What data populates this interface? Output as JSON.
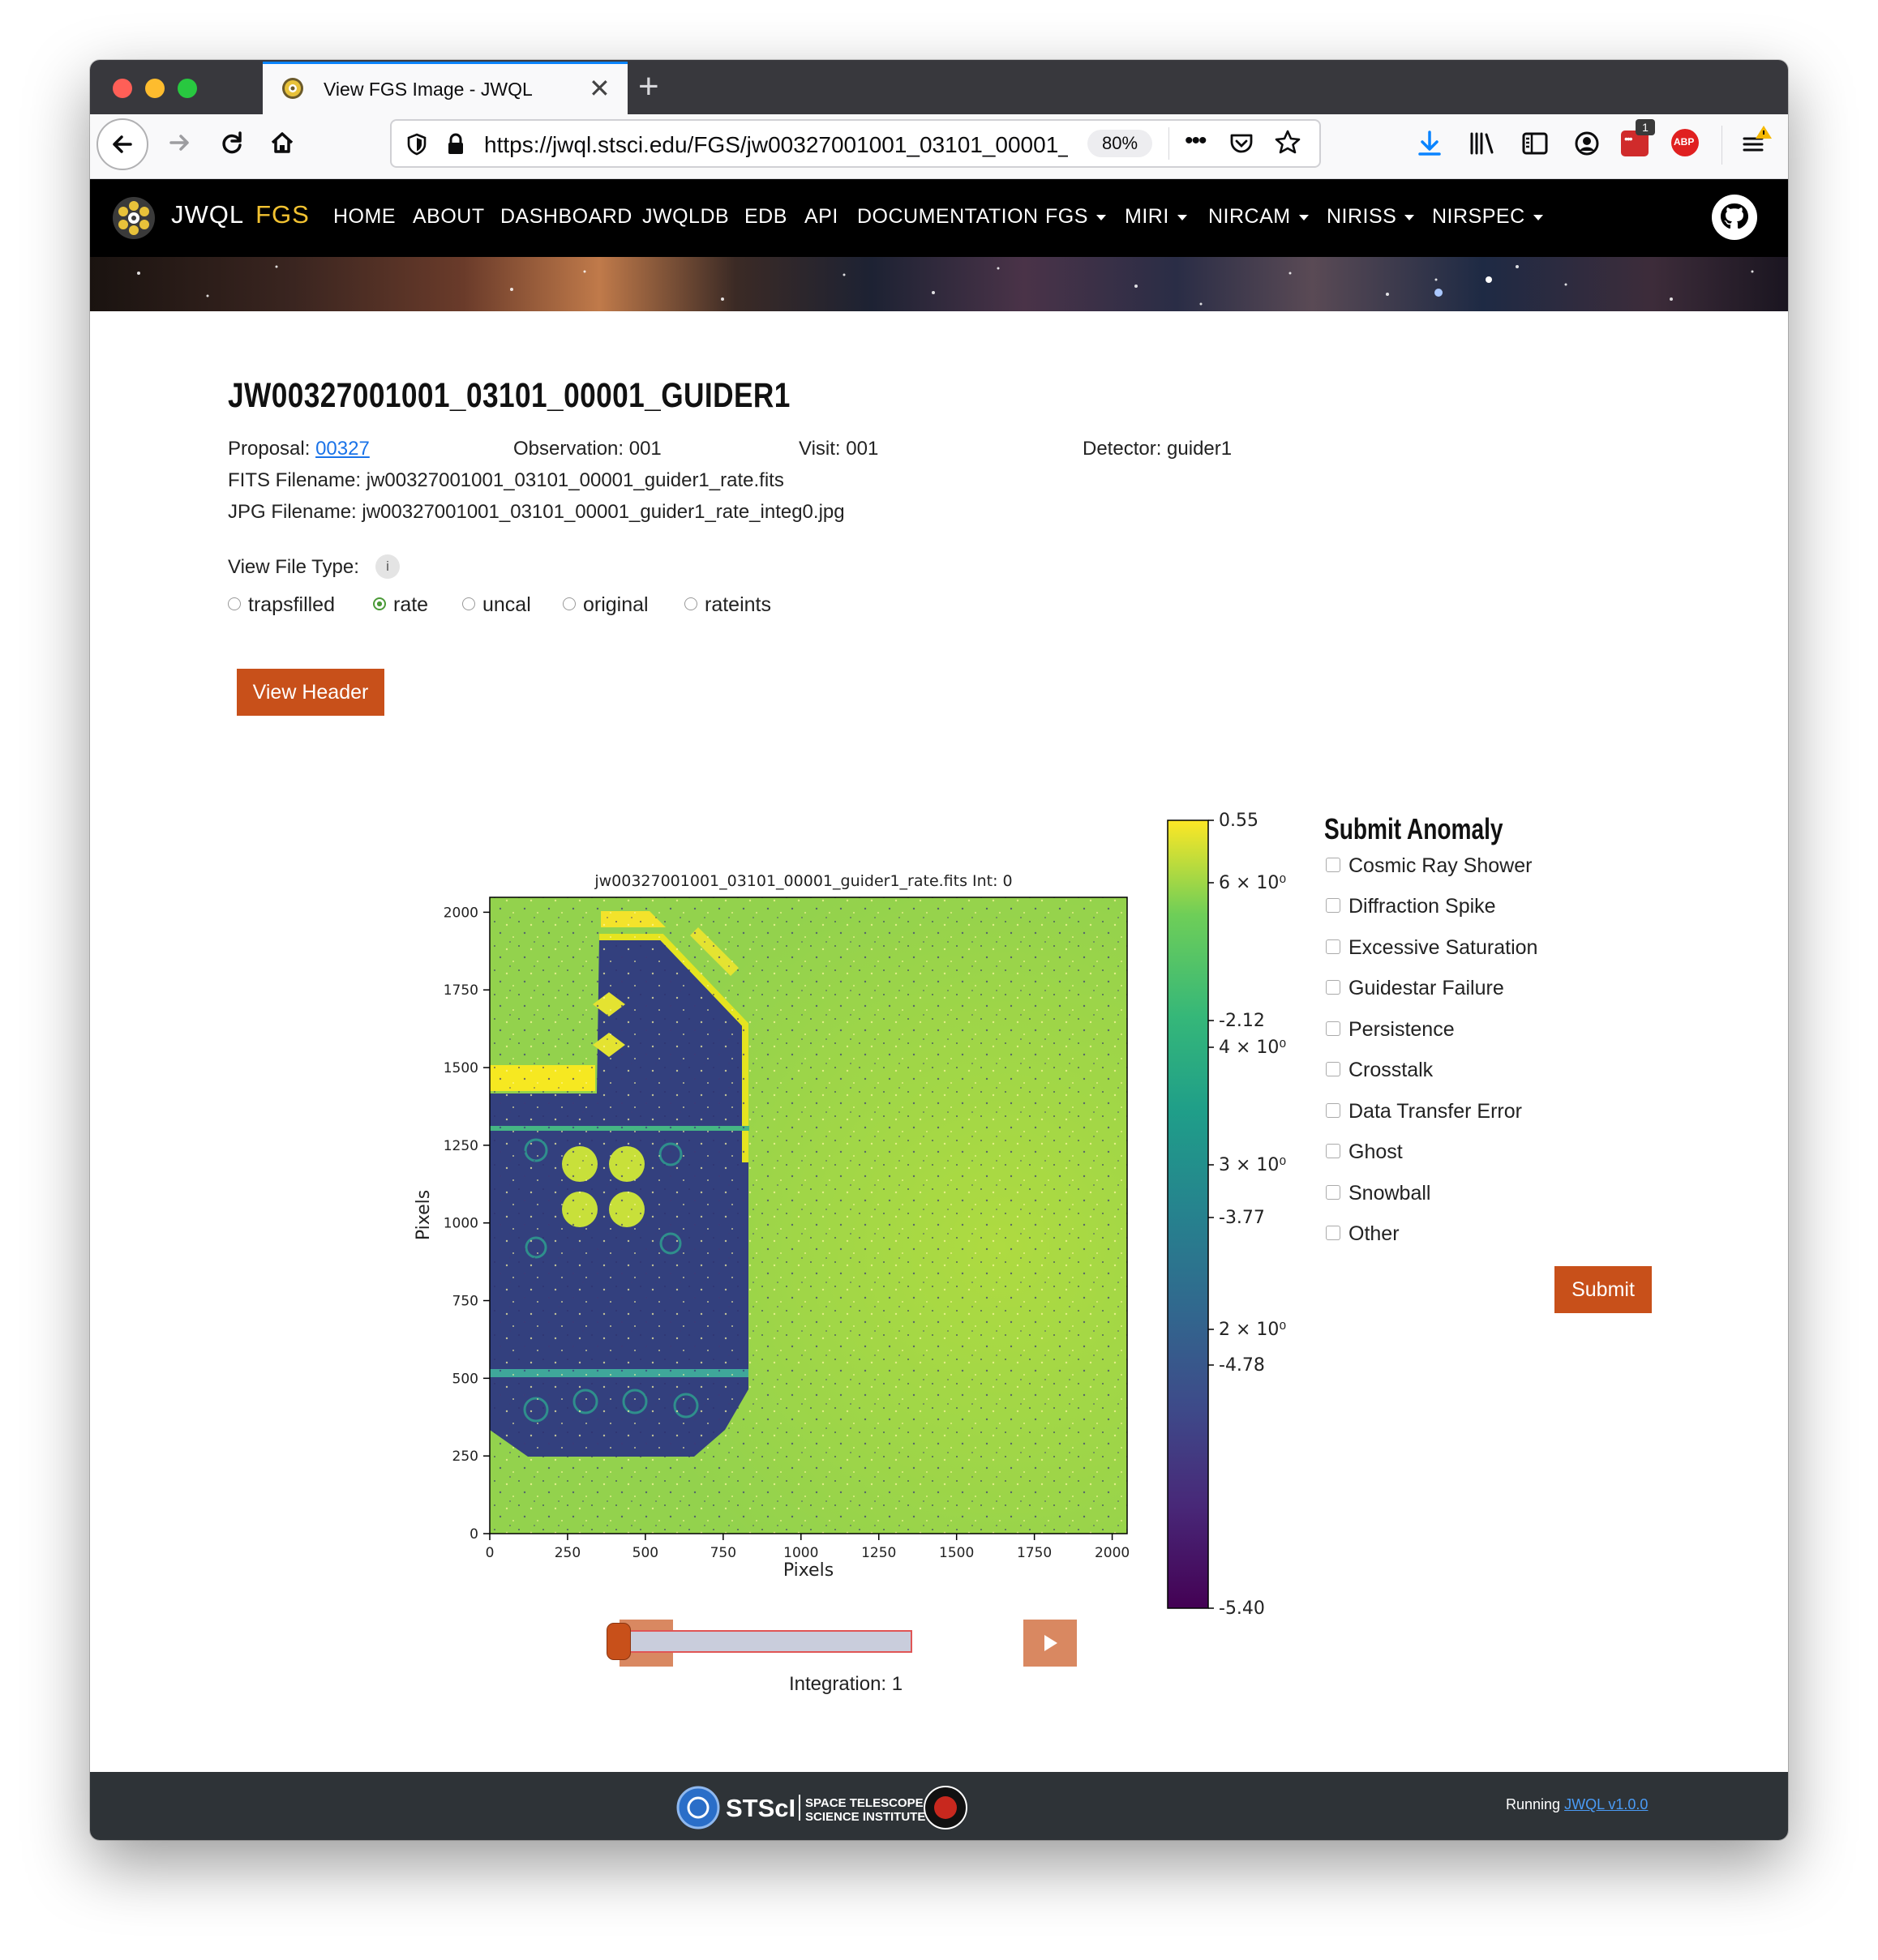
{
  "browser": {
    "tab_title": "View FGS Image - JWQL",
    "new_tab": "+",
    "tab_close": "✕",
    "url": "https://jwql.stsci.edu/FGS/jw00327001001_03101_00001_guider1_rate_integ0.jpg",
    "url_display": "https://jwql.stsci.edu/FGS/jw00327001001_03101_00001_",
    "zoom": "80%",
    "more_icon": "•••",
    "extension_badge": "1",
    "adblock_label": "ABP"
  },
  "site_nav": {
    "brand": "JWQL",
    "brand_sub": "FGS",
    "items": [
      {
        "label": "HOME",
        "dropdown": false
      },
      {
        "label": "ABOUT",
        "dropdown": false
      },
      {
        "label": "DASHBOARD",
        "dropdown": false
      },
      {
        "label": "JWQLDB",
        "dropdown": false
      },
      {
        "label": "EDB",
        "dropdown": false
      },
      {
        "label": "API",
        "dropdown": false
      },
      {
        "label": "DOCUMENTATION",
        "dropdown": false
      },
      {
        "label": "FGS",
        "dropdown": true
      },
      {
        "label": "MIRI",
        "dropdown": true
      },
      {
        "label": "NIRCAM",
        "dropdown": true
      },
      {
        "label": "NIRISS",
        "dropdown": true
      },
      {
        "label": "NIRSPEC",
        "dropdown": true
      }
    ]
  },
  "file": {
    "title": "JW00327001001_03101_00001_GUIDER1",
    "proposal_label": "Proposal:",
    "proposal_value": "00327",
    "observation": "Observation: 001",
    "visit": "Visit: 001",
    "detector": "Detector: guider1",
    "fits_filename": "FITS Filename: jw00327001001_03101_00001_guider1_rate.fits",
    "jpg_filename": "JPG Filename: jw00327001001_03101_00001_guider1_rate_integ0.jpg"
  },
  "file_type": {
    "label": "View File Type:",
    "info_icon": "i",
    "options": [
      "trapsfilled",
      "rate",
      "uncal",
      "original",
      "rateints"
    ],
    "selected": "rate"
  },
  "view_header_label": "View Header",
  "image_view": {
    "title": "jw00327001001_03101_00001_guider1_rate.fits Int: 0",
    "xlabel": "Pixels",
    "ylabel": "Pixels",
    "x_ticks": [
      0,
      250,
      500,
      750,
      1000,
      1250,
      1500,
      1750,
      2000
    ],
    "y_ticks": [
      0,
      250,
      500,
      750,
      1000,
      1250,
      1500,
      1750,
      2000
    ],
    "xlim": [
      0,
      2048
    ],
    "ylim": [
      0,
      2048
    ],
    "colormap": "viridis",
    "colorbar_labels": [
      "0.55",
      "6 × 10⁰",
      "-2.12",
      "4 × 10⁰",
      "3 × 10⁰",
      "-3.77",
      "2 × 10⁰",
      "-4.78",
      "-5.40"
    ]
  },
  "slider": {
    "integration_label": "Integration: 1",
    "value": 1,
    "min": 1,
    "max": 10
  },
  "anomaly": {
    "title": "Submit Anomaly",
    "options": [
      "Cosmic Ray Shower",
      "Diffraction Spike",
      "Excessive Saturation",
      "Guidestar Failure",
      "Persistence",
      "Crosstalk",
      "Data Transfer Error",
      "Ghost",
      "Snowball",
      "Other"
    ],
    "submit_label": "Submit"
  },
  "footer": {
    "logo_text": "STScI",
    "logo_sub1": "SPACE TELESCOPE",
    "logo_sub2": "SCIENCE INSTITUTE",
    "running_label": "Running",
    "version_link": "JWQL v1.0.0"
  },
  "colors": {
    "accent_orange": "#c8501a",
    "brand_yellow": "#f2c231",
    "link_blue": "#1a73e8",
    "nav_bg": "#000000",
    "footer_bg": "#2e3337"
  }
}
